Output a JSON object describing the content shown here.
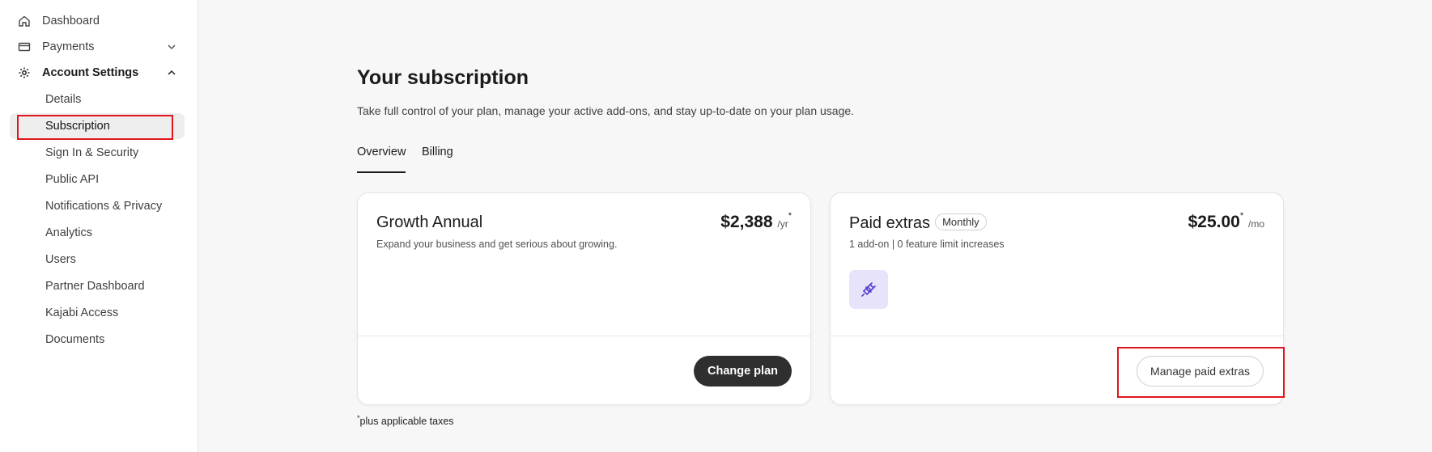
{
  "sidebar": {
    "dashboard": "Dashboard",
    "payments": "Payments",
    "account_settings": "Account Settings",
    "sub_items": [
      "Details",
      "Subscription",
      "Sign In & Security",
      "Public API",
      "Notifications & Privacy",
      "Analytics",
      "Users",
      "Partner Dashboard",
      "Kajabi Access",
      "Documents"
    ],
    "active_item": "Subscription"
  },
  "header": {
    "title": "Your subscription",
    "subtitle": "Take full control of your plan, manage your active add-ons, and stay up-to-date on your plan usage."
  },
  "tabs": [
    {
      "label": "Overview",
      "active": true
    },
    {
      "label": "Billing",
      "active": false
    }
  ],
  "plan_card": {
    "title": "Growth Annual",
    "description": "Expand your business and get serious about growing.",
    "price": "$2,388",
    "period": "/yr",
    "asterisk": "*",
    "button": "Change plan"
  },
  "extras_card": {
    "title": "Paid extras",
    "badge": "Monthly",
    "summary": "1 add-on | 0 feature limit increases",
    "price": "$25.00",
    "asterisk": "*",
    "period": "/mo",
    "addon_icon": "plug-icon",
    "button": "Manage paid extras"
  },
  "footnote": {
    "asterisk": "*",
    "text": "plus applicable taxes"
  },
  "colors": {
    "highlight": "#e0161b",
    "dark_button": "#2f2f2f",
    "addon_bg": "#e7e3fb",
    "addon_icon": "#5b3fd0"
  }
}
